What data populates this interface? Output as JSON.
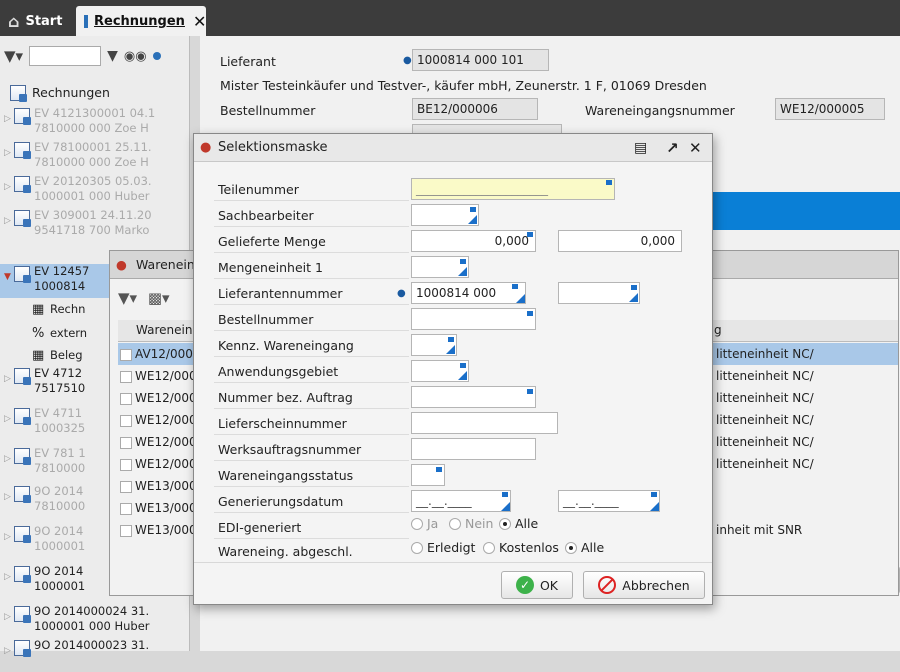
{
  "tabs": {
    "start": "Start",
    "rechnungen": "Rechnungen"
  },
  "tree": {
    "root": "Rechnungen",
    "items": [
      {
        "l1": "EV 4121300001 04.1",
        "l2": "7810000 000 Zoe H"
      },
      {
        "l1": "EV 78100001 25.11.",
        "l2": "7810000 000 Zoe H"
      },
      {
        "l1": "EV 20120305 05.03.",
        "l2": "1000001 000 Huber"
      },
      {
        "l1": "EV 309001 24.11.20",
        "l2": "9541718 700 Marko"
      },
      {
        "l1": "EV 12457",
        "l2": "1000814"
      }
    ],
    "sub": [
      "Rechn",
      "extern",
      "Beleg"
    ],
    "more": [
      {
        "l1": "EV 4712",
        "l2": "7517510"
      },
      {
        "l1": "EV 4711",
        "l2": "1000325"
      },
      {
        "l1": "EV 781 1",
        "l2": "7810000"
      },
      {
        "l1": "9O 2014",
        "l2": "7810000"
      },
      {
        "l1": "9O 2014",
        "l2": "1000001"
      },
      {
        "l1": "9O 2014",
        "l2": "1000001"
      },
      {
        "l1": "9O 2014000024 31.",
        "l2": "1000001 000 Huber"
      },
      {
        "l1": "9O 2014000023 31.",
        "l2": ""
      }
    ]
  },
  "main": {
    "lieferant_label": "Lieferant",
    "lieferant_value": "1000814 000 101",
    "address": "Mister Testeinkäufer und Testver-, käufer mbH, Zeunerstr. 1 F, 01069 Dresden",
    "bestellnummer_label": "Bestellnummer",
    "bestellnummer_value": "BE12/000006",
    "wareneingangsnummer_label": "Wareneingangsnummer",
    "wareneingangsnummer_value": "WE12/000005",
    "ok_label": "OK"
  },
  "we_window": {
    "title": "Wareneing",
    "col1": "Wareneing",
    "col2": "g",
    "rows": [
      {
        "c1": "AV12/00000",
        "c2": "litteneinheit NC/",
        "sel": true
      },
      {
        "c1": "WE12/0000",
        "c2": "litteneinheit NC/"
      },
      {
        "c1": "WE12/0000",
        "c2": "litteneinheit NC/"
      },
      {
        "c1": "WE12/0000",
        "c2": "litteneinheit NC/"
      },
      {
        "c1": "WE12/0000",
        "c2": "litteneinheit NC/"
      },
      {
        "c1": "WE12/0000",
        "c2": "litteneinheit NC/"
      },
      {
        "c1": "WE13/0000",
        "c2": ""
      },
      {
        "c1": "WE13/0000",
        "c2": ""
      },
      {
        "c1": "WE13/0000",
        "c2": "inheit mit SNR"
      }
    ]
  },
  "dialog": {
    "title": "Selektionsmaske",
    "labels": {
      "teilenummer": "Teilenummer",
      "sachbearbeiter": "Sachbearbeiter",
      "gelieferte_menge": "Gelieferte Menge",
      "mengeneinheit": "Mengeneinheit 1",
      "lieferantennummer": "Lieferantennummer",
      "bestellnummer": "Bestellnummer",
      "kennz": "Kennz. Wareneingang",
      "anwendungsgebiet": "Anwendungsgebiet",
      "nummer_auftrag": "Nummer bez. Auftrag",
      "lieferscheinnummer": "Lieferscheinnummer",
      "werksauftragsnummer": "Werksauftragsnummer",
      "status": "Wareneingangsstatus",
      "generierungsdatum": "Generierungsdatum",
      "edi": "EDI-generiert",
      "abgeschl": "Wareneing. abgeschl."
    },
    "values": {
      "teilenummer": "______________________",
      "menge_von": "0,000",
      "menge_bis": "0,000",
      "lieferantennummer": "1000814 000",
      "datum_von": "__.__.____",
      "datum_bis": "__.__.____"
    },
    "edi_options": [
      "Ja",
      "Nein",
      "Alle"
    ],
    "abgeschl_options": [
      "Erledigt",
      "Kostenlos",
      "Alle"
    ],
    "ok_label": "OK",
    "cancel_label": "Abbrechen"
  }
}
